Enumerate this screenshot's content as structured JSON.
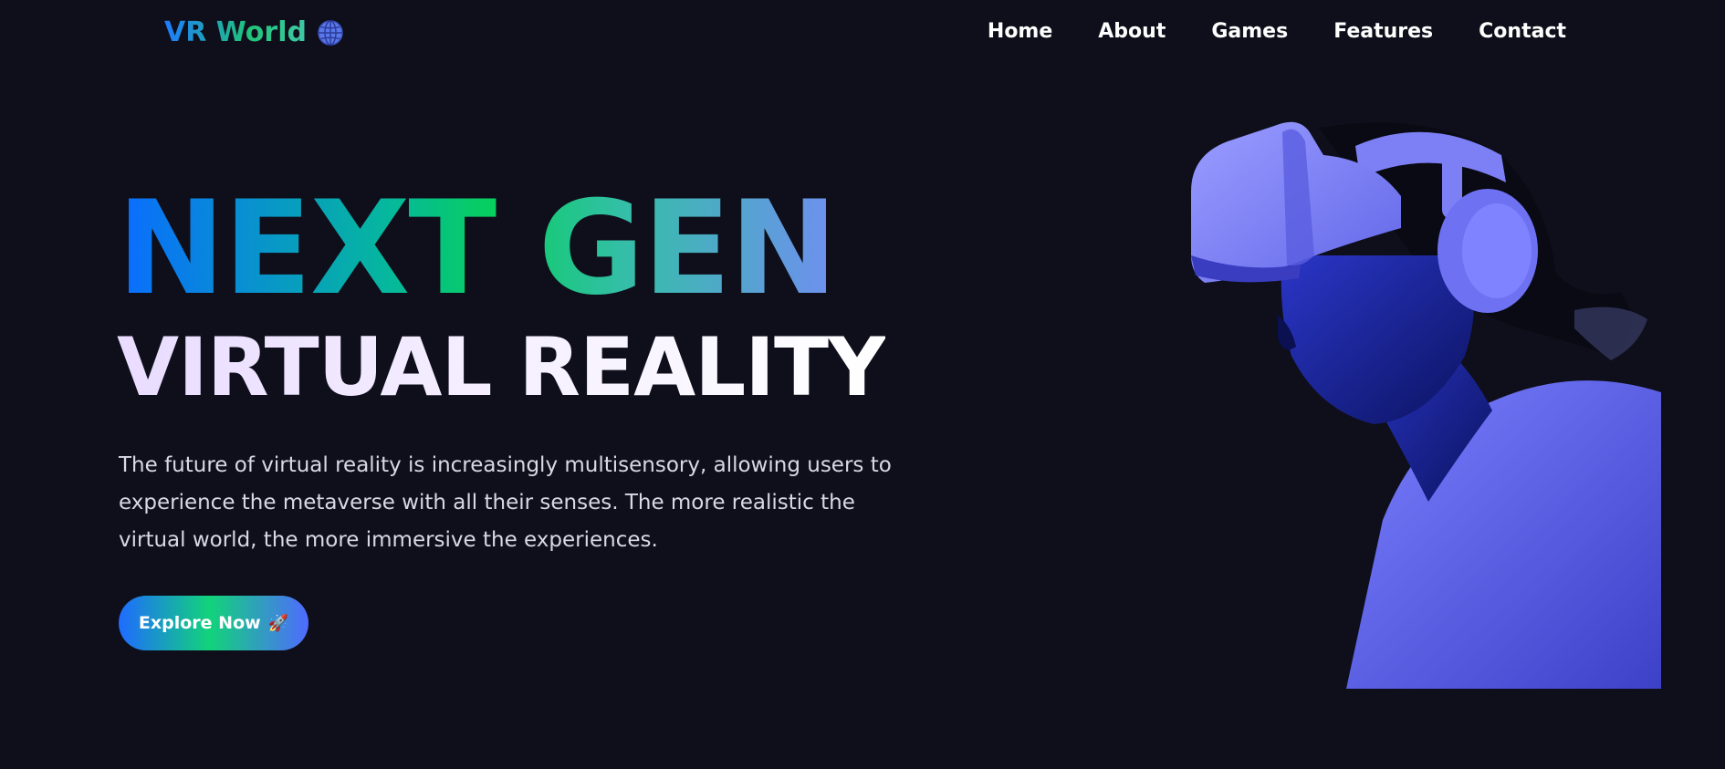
{
  "header": {
    "logo_text": "VR World",
    "logo_icon": "globe-icon",
    "nav": {
      "home": "Home",
      "about": "About",
      "games": "Games",
      "features": "Features",
      "contact": "Contact"
    }
  },
  "hero": {
    "title_line1": "NEXT GEN",
    "title_line2": "VIRTUAL REALITY",
    "description": "The future of virtual reality is increasingly multisensory, allowing users to experience the metaverse with all their senses. The more realistic the virtual world, the more immersive the experiences.",
    "cta_label": "Explore Now",
    "cta_icon": "rocket-icon",
    "image_alt": "Person wearing VR headset and headphones"
  },
  "colors": {
    "background": "#0e0f1a",
    "accent_blue": "#0a6cff",
    "accent_green": "#07cf5e",
    "accent_violet": "#6f7ff0",
    "image_tint": "#6a6ef5"
  }
}
